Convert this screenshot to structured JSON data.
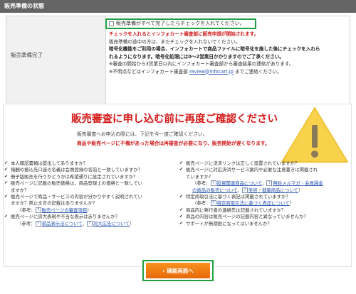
{
  "section_title": "販売準備の状態",
  "status": {
    "label": "販売準備完了",
    "checkbox_text": "販売準備がすべて完了したらチェックを入れてください。",
    "lines": [
      {
        "text": "チェックを入れるとインフォカート審査部に販売申請が開始されます。",
        "style": "red"
      },
      {
        "text": "販売準備の途中の方は、まだチェックを入れないでください。",
        "style": "normal"
      },
      {
        "text": "暗号化機能をご利用の場合、インフォカートで商品ファイルに暗号化を施した後にチェックを入れら",
        "style": "bold"
      },
      {
        "text": "れるようになります。暗号化処理には0～2営業日かかりますのでご了承ください。",
        "style": "bold"
      },
      {
        "text": "※審査の開始から3営業日以内にインフォカート審査部から審査結果の連絡があります。",
        "style": "normal"
      }
    ],
    "contact_prefix": "※不明点などはインフォカート審査部",
    "contact_email": "review@infocart.jp",
    "contact_suffix": "までご連絡ください。"
  },
  "confirm": {
    "title": "販売審査に申し込む前に再度ご確認ください",
    "intro1": "販売審査へお申込の際には、下記を今一度ご確認ください。",
    "intro2": "商品や販売ページに不備があった場合は再審査が必要になり、販売開始が遅くなります。",
    "left": {
      "i1": "本人確認書類は提出してありますか？",
      "i2": "報酬の振込先口座の名義は会員登録の名前と一致していますか？",
      "i3": "冊子版販売を行うかどうかは希望通りに設定されていますか？",
      "i4a": "販売ページに記載の販売価格は、商品登録上の価格と一致してい",
      "i4b": "ますか？",
      "i5a": "販売ページで商品・サービスの内容が分かりやすく説明されてい",
      "i5b": "ますか？禁止文言の記載はありませんか？",
      "i5c_prefix": "（参考：",
      "i5c_link": "販売ページの審査項目",
      "i5c_suffix": "）",
      "i6": "販売ページに誇大表現や不当な表示はありませんか？",
      "i6b_prefix": "（参考：",
      "i6b_link1": "景品表示法について",
      "i6b_sep": "、",
      "i6b_link2": "誇大広告について",
      "i6b_suffix": "）"
    },
    "right": {
      "i1": "販売ページに決済リンクは正しく設置されていますか？",
      "i2a": "販売ページに対応決済サービス案内や必要な注意書きは掲載され",
      "i2b": "ていますか？",
      "i2c_prefix": "（参考：",
      "i2c_link1": "投資関連商品について",
      "i2c_sep": "、",
      "i2c_link2": "無料メルマガ・会員課金",
      "i2c_link3": "の商品の販売について",
      "i2c_link4": "美容・健康商品について",
      "i2c_suffix": "）",
      "i3": "特定商取引法に基づく表記は掲載されていますか？",
      "i3b_prefix": "（参考：",
      "i3b_link": "特定商取引法に基づく表記について",
      "i3b_suffix": "）",
      "i4": "商品内に発行者の連絡先は記載されていますか？",
      "i5": "商品の内容は販売ページの記載内容と異なっていませんか？",
      "i6": "サポートが無期限になってはいませんか？"
    }
  },
  "button": {
    "label": "確認画面へ",
    "arrow": "›"
  },
  "colors": {
    "accent_red": "#d41a1a",
    "button_orange": "#f08a1a",
    "highlight_green": "#20a040",
    "warning_yellow": "#f7d24a"
  },
  "icons": {
    "warning": "warning-icon",
    "checkmark": "check-icon",
    "help": "help-icon"
  }
}
